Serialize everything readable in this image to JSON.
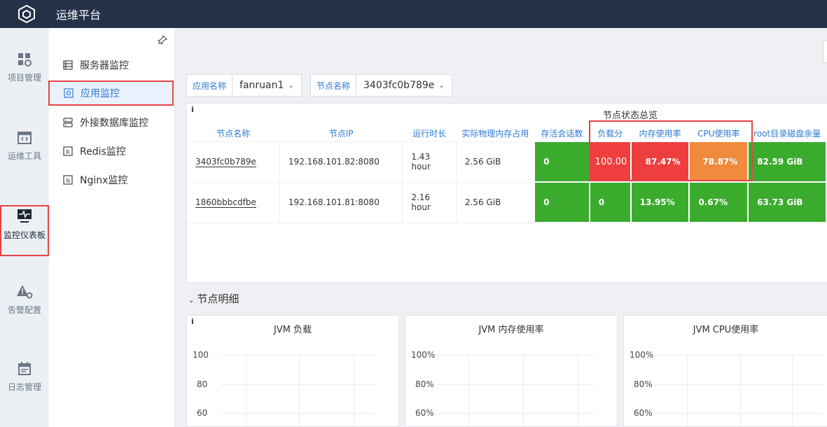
{
  "header": {
    "title": "运维平台",
    "logo": "cube-logo"
  },
  "rail": [
    {
      "label": "项目管理",
      "icon": "grid-gear-icon"
    },
    {
      "label": "运维工具",
      "icon": "code-window-icon"
    },
    {
      "label": "监控仪表板",
      "icon": "monitor-pulse-icon",
      "active": true
    },
    {
      "label": "告警配置",
      "icon": "warning-gear-icon"
    },
    {
      "label": "日志管理",
      "icon": "calendar-log-icon"
    }
  ],
  "subnav": [
    {
      "label": "服务器监控",
      "icon": "server-list-icon"
    },
    {
      "label": "应用监控",
      "icon": "app-monitor-icon",
      "active": true
    },
    {
      "label": "外接数据库监控",
      "icon": "database-icon"
    },
    {
      "label": "Redis监控",
      "icon": "redis-icon"
    },
    {
      "label": "Nginx监控",
      "icon": "nginx-icon"
    }
  ],
  "filters": {
    "app_label": "应用名称",
    "app_value": "fanruan1",
    "node_label": "节点名称",
    "node_value": "3403fc0b789e"
  },
  "overview": {
    "title": "节点状态总览",
    "columns": [
      "节点名称",
      "节点IP",
      "运行时长",
      "实际物理内存占用",
      "存活会话数",
      "负载分",
      "内存使用率",
      "CPU使用率",
      "root目录磁盘余量"
    ],
    "rows": [
      {
        "name": "3403fc0b789e",
        "ip": "192.168.101.82:8080",
        "uptime_value": "1.43",
        "uptime_unit": "hour",
        "memory": "2.56 GiB",
        "sessions": "0",
        "load": "100.00",
        "mem_usage": "87.47%",
        "cpu_usage": "78.87%",
        "disk": "82.59 GiB"
      },
      {
        "name": "1860bbbcdfbe",
        "ip": "192.168.101.81:8080",
        "uptime_value": "2.16",
        "uptime_unit": "hour",
        "memory": "2.56 GiB",
        "sessions": "0",
        "load": "0",
        "mem_usage": "13.95%",
        "cpu_usage": "0.67%",
        "disk": "63.73 GiB"
      }
    ],
    "cell_colors": {
      "ok": "#3bab2e",
      "critical": "#ee3e3e",
      "warning": "#f08a3d"
    }
  },
  "detail": {
    "title": "节点明细",
    "charts": [
      {
        "title": "JVM 负载",
        "ticks": [
          "100",
          "80",
          "60"
        ]
      },
      {
        "title": "JVM 内存使用率",
        "ticks": [
          "100%",
          "80%",
          "60%"
        ]
      },
      {
        "title": "JVM CPU使用率",
        "ticks": [
          "100%",
          "80%",
          "60%"
        ]
      }
    ]
  },
  "accent": "#2d7ad6",
  "highlight": "#e64343"
}
